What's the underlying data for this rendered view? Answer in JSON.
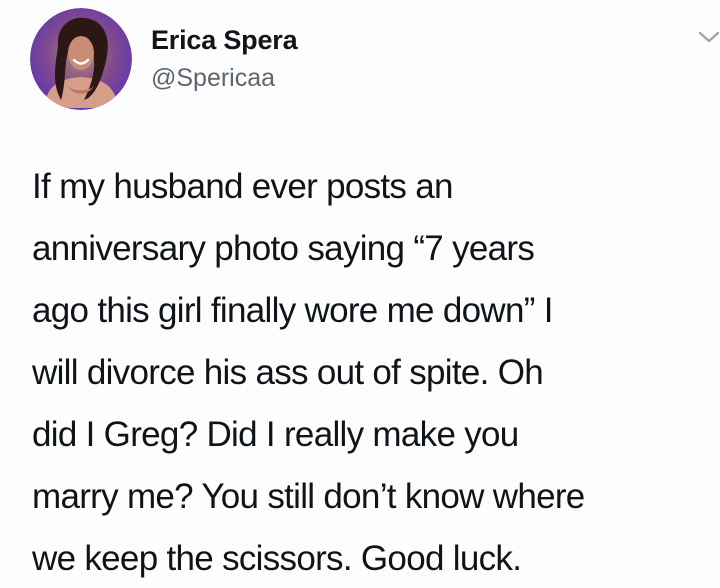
{
  "author": {
    "display_name": "Erica Spera",
    "handle": "@Spericaa",
    "avatar_icon": "profile-photo"
  },
  "tweet": {
    "lines": [
      "If my husband ever posts an",
      "anniversary photo saying “7 years",
      "ago this girl finally wore me down” I",
      "will divorce his ass out of spite. Oh",
      "did I Greg? Did I really make you",
      "marry me? You still don’t know where",
      "we keep the scissors. Good luck."
    ]
  },
  "icons": {
    "menu": "chevron-down-icon"
  },
  "colors": {
    "background": "#fdfdfd",
    "text": "#0f1419",
    "secondary_text": "#5b6670",
    "avatar_ring": "#5f35b2"
  }
}
